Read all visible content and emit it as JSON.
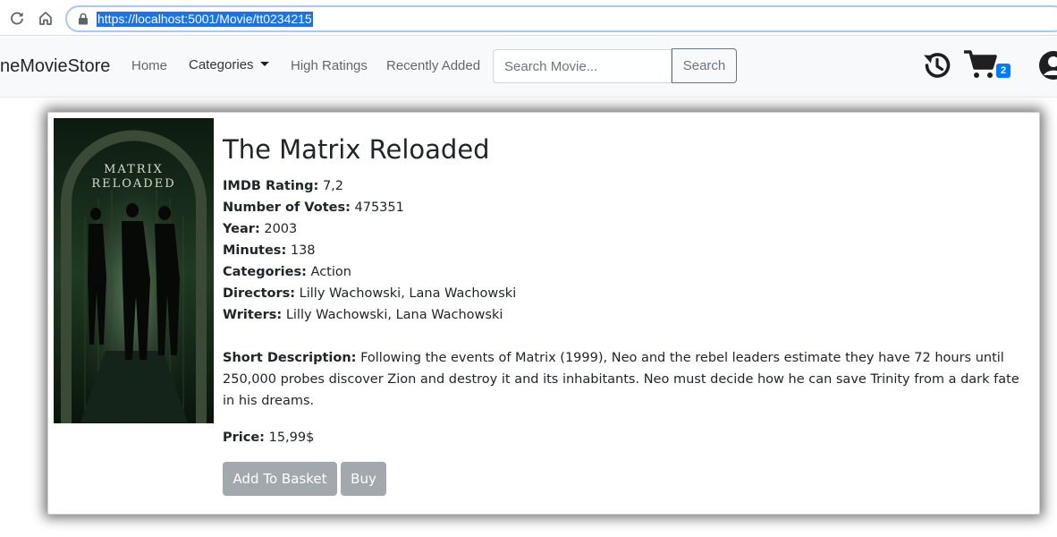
{
  "browser": {
    "url": "https://localhost:5001/Movie/tt0234215"
  },
  "navbar": {
    "brand": "neMovieStore",
    "links": {
      "home": "Home",
      "categories": "Categories",
      "high_ratings": "High Ratings",
      "recently_added": "Recently Added"
    },
    "search": {
      "placeholder": "Search Movie...",
      "value": "",
      "button_label": "Search"
    },
    "icons": [
      "history-icon",
      "cart-icon",
      "user-icon"
    ],
    "cart_count": "2"
  },
  "movie": {
    "poster_title_line1": "MATRIX",
    "poster_title_line2": "RELOADED",
    "title": "The Matrix Reloaded",
    "fields": {
      "rating_label": "IMDB Rating:",
      "rating": "7,2",
      "votes_label": "Number of Votes:",
      "votes": "475351",
      "year_label": "Year:",
      "year": "2003",
      "minutes_label": "Minutes:",
      "minutes": "138",
      "categories_label": "Categories:",
      "categories": "Action",
      "directors_label": "Directors:",
      "directors": "Lilly Wachowski, Lana Wachowski",
      "writers_label": "Writers:",
      "writers": "Lilly Wachowski, Lana Wachowski"
    },
    "description_label": "Short Description:",
    "description": "Following the events of Matrix (1999), Neo and the rebel leaders estimate they have 72 hours until 250,000 probes discover Zion and destroy it and its inhabitants. Neo must decide how he can save Trinity from a dark fate in his dreams.",
    "price_label": "Price:",
    "price": "15,99$"
  },
  "actions": {
    "add_to_basket": "Add To Basket",
    "buy": "Buy"
  },
  "colors": {
    "accent_blue": "#007bff",
    "button_gray": "#a3a8ae",
    "url_highlight": "#1a73e8"
  }
}
